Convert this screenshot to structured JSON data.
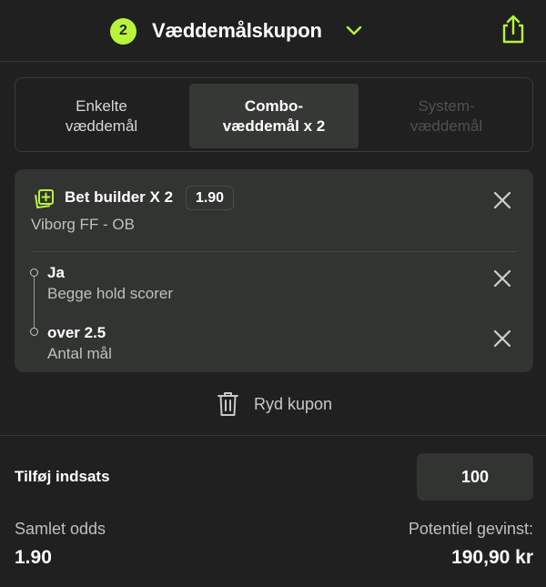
{
  "header": {
    "count": "2",
    "title": "Væddemålskupon"
  },
  "tabs": [
    {
      "line1": "Enkelte",
      "line2": "væddemål"
    },
    {
      "line1": "Combo-",
      "line2": "væddemål x 2"
    },
    {
      "line1": "System-",
      "line2": "væddemål"
    }
  ],
  "coupon": {
    "title": "Bet builder X 2",
    "odds": "1.90",
    "match": "Viborg FF - OB",
    "selections": [
      {
        "name": "Ja",
        "market": "Begge hold scorer"
      },
      {
        "name": "over 2.5",
        "market": "Antal mål"
      }
    ]
  },
  "clear_label": "Ryd kupon",
  "stake": {
    "label": "Tilføj indsats",
    "value": "100"
  },
  "totals": {
    "odds_label": "Samlet odds",
    "odds_value": "1.90",
    "win_label": "Potentiel gevinst:",
    "win_value": "190,90 kr"
  },
  "colors": {
    "background": "#1f201f",
    "card": "#323432",
    "accent": "#b8f53a",
    "active_tab": "#363836"
  },
  "icons": {
    "chevron": "chevron-down-icon",
    "share": "share-icon",
    "bet_builder": "bet-builder-icon",
    "close": "close-icon",
    "trash": "trash-icon"
  }
}
